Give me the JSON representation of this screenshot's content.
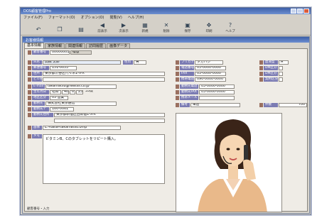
{
  "app": {
    "title": "DOS顧客管理Pro",
    "menu": [
      "ファイル(F)",
      "フォーマット(O)",
      "オプション(O)",
      "閲覧(V)",
      "ヘルプ(H)"
    ],
    "toolbar": [
      {
        "label": "",
        "icon": "undo-icon"
      },
      {
        "label": "",
        "icon": "copy-icon"
      },
      {
        "label": "",
        "icon": "paste-icon"
      },
      {
        "label": "前表示",
        "icon": "prev-icon"
      },
      {
        "label": "次表示",
        "icon": "next-icon"
      },
      {
        "label": "新規",
        "icon": "new-icon"
      },
      {
        "label": "削除",
        "icon": "delete-icon"
      },
      {
        "label": "保存",
        "icon": "save-icon"
      },
      {
        "label": "印刷",
        "icon": "print-icon"
      },
      {
        "label": "ヘルプ",
        "icon": "help-icon"
      }
    ]
  },
  "child": {
    "title": "お客様情報",
    "tabs": [
      "基本情報",
      "家族情報",
      "関連情報",
      "訪問履歴",
      "画像データ"
    ],
    "form": {
      "customer_no": "00000001",
      "customer_no_suffix": "得意",
      "name": "高橋 太郎",
      "gender": "男",
      "postal": "151-0053",
      "address1": "東京都渋谷区代々木1-X-X",
      "address2": "",
      "email": "takamatsu@fwatss.co.jp",
      "birth_era": "昭和",
      "birth_year": "40",
      "birth_month": "6",
      "birth_day": "23",
      "birth_age": "35歳",
      "district": "03 営業",
      "company": "株式会社東京通信",
      "company_postal": "160-0061",
      "company_address": "東京都新宿区西新宿1-X-X",
      "image_path": "E:¥data¥takamatsu.bmp",
      "memo": "ビタミンB、Cのタブレットをリピート購入。",
      "kana": "タカハシ",
      "tel": "03-0000-0000",
      "fax": "03-0000-0000",
      "mobile": "090-0000-0000",
      "work_tel": "03-0000-0000",
      "work_fax": "03-0000-0000",
      "mobile_mail": "",
      "blood": "A",
      "status": "来店",
      "count": "700"
    },
    "labels": {
      "customer_no": "顧客番号",
      "name": "氏名",
      "gender": "性別",
      "postal": "郵便番号",
      "address1": "住所",
      "address2": "ビル名",
      "email": "E-mail",
      "birth": "生年月日",
      "district": "地区区分",
      "company": "勤務先",
      "company_postal": "勤務先〒",
      "company_address": "勤務先住所",
      "image": "画像",
      "memo": "メモ",
      "kana": "フリガナ",
      "tel": "電話番号",
      "fax": "FAX",
      "mobile": "携帯電話",
      "work_tel": "勤務先電話",
      "work_fax": "勤務先FAX",
      "mobile_mail": "携帯メール",
      "blood": "血液型",
      "dm": "DM区分",
      "dm2": "DM区分",
      "contract": "契約区分",
      "note": "備考",
      "status": "状態",
      "count": "件数"
    }
  },
  "statusbar": "顧客番号・入力"
}
